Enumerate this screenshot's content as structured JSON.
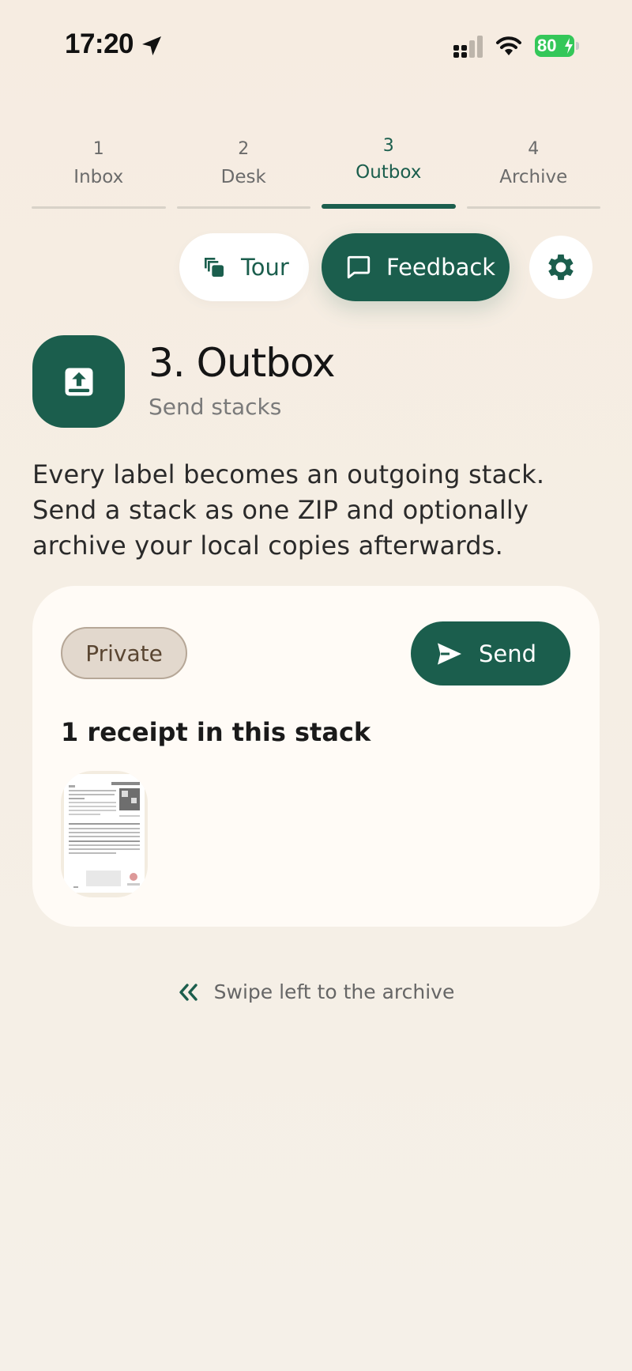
{
  "status_bar": {
    "time": "17:20",
    "battery": "80",
    "icons": [
      "location-arrow-icon",
      "signal-icon",
      "wifi-icon",
      "battery-charging-icon"
    ]
  },
  "tabs": [
    {
      "number": "1",
      "label": "Inbox",
      "active": false
    },
    {
      "number": "2",
      "label": "Desk",
      "active": false
    },
    {
      "number": "3",
      "label": "Outbox",
      "active": true
    },
    {
      "number": "4",
      "label": "Archive",
      "active": false
    }
  ],
  "actions": {
    "tour_label": "Tour",
    "feedback_label": "Feedback",
    "settings_icon": "gear-icon"
  },
  "header": {
    "icon": "outbox-upload-icon",
    "title": "3. Outbox",
    "subtitle": "Send stacks"
  },
  "description": "Every label becomes an outgoing stack. Send a stack as one ZIP and optionally archive your local copies afterwards.",
  "stack_card": {
    "label_chip": "Private",
    "send_label": "Send",
    "count_text": "1 receipt in this stack"
  },
  "swipe_hint": "Swipe left to the archive",
  "colors": {
    "accent": "#1b5e4d",
    "background": "#f6ece1",
    "card": "#fffbf6",
    "chip": "#e2d8cd",
    "battery": "#34c759"
  }
}
